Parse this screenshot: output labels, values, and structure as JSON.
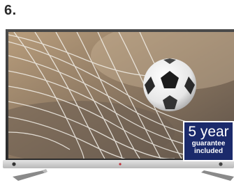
{
  "item": {
    "number": "6."
  },
  "product": {
    "image": "lg-television-football-net",
    "badge": {
      "line1": "5 year",
      "line2": "guarantee",
      "line3": "included",
      "background_color": "#1b2a6b",
      "text_color": "#ffffff"
    }
  }
}
